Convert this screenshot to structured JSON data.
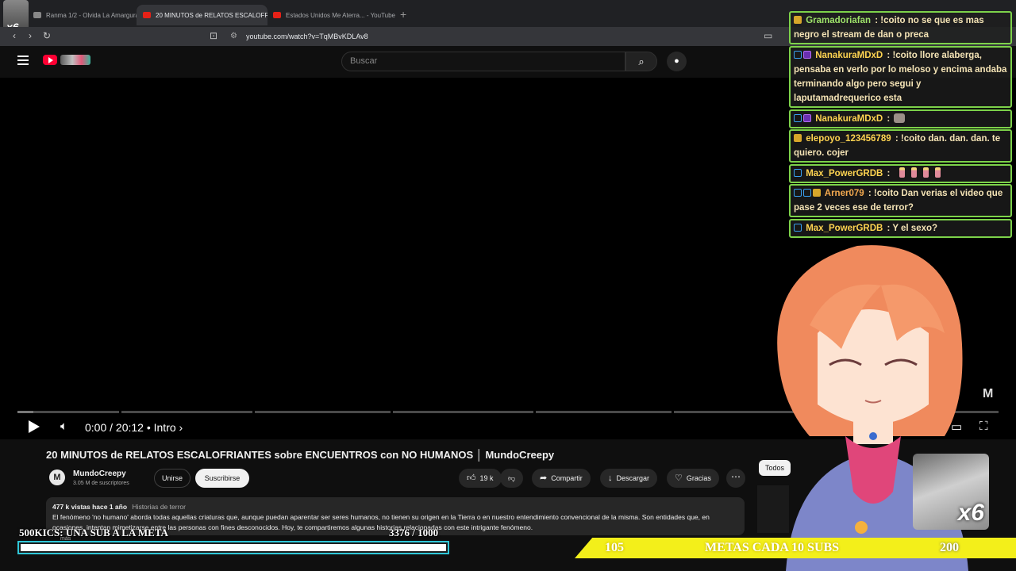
{
  "browser": {
    "tabs": [
      {
        "label": "Ranma 1/2 - Olvida La Amargura"
      },
      {
        "label": "20 MINUTOS de RELATOS ESCALOFRIANTES"
      },
      {
        "label": "Estados Unidos Me Aterra... - YouTube"
      }
    ],
    "url": "youtube.com/watch?v=TqMBvKDLAv8"
  },
  "youtube": {
    "search_placeholder": "Buscar",
    "player": {
      "time": "0:00 / 20:12",
      "chapter": "• Intro ›",
      "progress_fraction": 0.0
    },
    "video_title": "20 MINUTOS de RELATOS ESCALOFRIANTES sobre ENCUENTROS con NO HUMANOS │ MundoCreepy",
    "channel": {
      "name": "MundoCreepy",
      "subscribers": "3.05 M de suscriptores",
      "join_label": "Unirse",
      "subscribe_label": "Suscribirse"
    },
    "actions": {
      "likes": "19 k",
      "share": "Compartir",
      "download": "Descargar",
      "thanks": "Gracias"
    },
    "description": {
      "views": "477 k vistas",
      "age": "hace 1 año",
      "tag": "Historias de terror",
      "text": "El fenómeno 'no humano' aborda todas aquellas criaturas que, aunque puedan aparentar ser seres humanos, no tienen su origen en la Tierra o en nuestro entendimiento convencional de la misma. Son entidades que, en ocasiones, intentan mimetizarse entre las personas con fines desconocidos. Hoy, te compartiremos algunas historias relacionadas con este intrigante fenómeno.",
      "more": "más"
    },
    "filter_chip": "Todos"
  },
  "chat": [
    {
      "user": "Gramadoriafan",
      "message": "!coito no se que es mas negro el stream de dan o preca"
    },
    {
      "user": "NanakuraMDxD",
      "message": "!coito llore alaberga, pensaba en verlo por lo meloso y encima andaba terminando algo pero segui y laputamadrequerico esta"
    },
    {
      "user": "NanakuraMDxD",
      "message": ""
    },
    {
      "user": "elepoyo_123456789",
      "message": "!coito dan. dan. dan. te quiero. cojer"
    },
    {
      "user": "Max_PowerGRDB",
      "message": ""
    },
    {
      "user": "Arner079",
      "message": "!coito Dan verias el video que pase 2 veces ese de terror?"
    },
    {
      "user": "Max_PowerGRDB",
      "message": "Y el sexo?"
    }
  ],
  "overlay": {
    "sub_goal_label": "500KICS: UNA SUB A LA META",
    "sub_goal_count": "3376 / 1000",
    "sub_goal_fill_fraction": 1.0,
    "metas_left": "105",
    "metas_label": "METAS CADA 10 SUBS",
    "metas_right": "200",
    "cam_tag": "x6",
    "corner_tag": "x6"
  },
  "colors": {
    "chat_border": "#7dd24a",
    "goal_border": "#2fc7d8",
    "meta_bar": "#f3ef1a",
    "yt_red": "#ff0033"
  }
}
